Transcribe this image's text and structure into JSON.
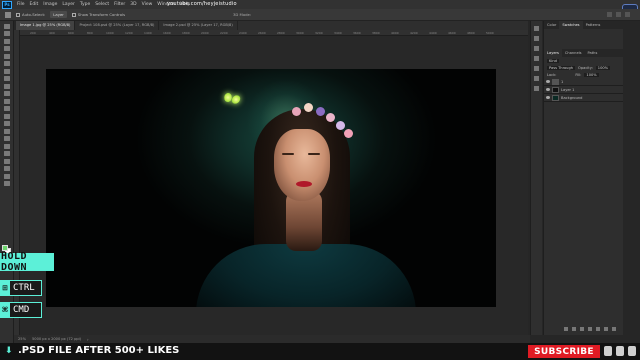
{
  "menu": {
    "app_icon": "Ps",
    "items": [
      "File",
      "Edit",
      "Image",
      "Layer",
      "Type",
      "Select",
      "Filter",
      "3D",
      "View",
      "Window",
      "Help"
    ],
    "watermark": "youtube.com/heyjeistudio"
  },
  "options_bar": {
    "auto_select_label": "Auto-Select:",
    "auto_select_value": "Layer",
    "show_transform": "Show Transform Controls",
    "mode_3d": "3D Mode:"
  },
  "tabs": [
    {
      "label": "Image 1.jpg @ 25% (RGB/8)",
      "active": true
    },
    {
      "label": "Project 108.psd @ 25% (Layer 17, RGB/8)",
      "active": false
    },
    {
      "label": "Image 2.psd @ 25% (Layer 17, RGB/8)",
      "active": false
    }
  ],
  "ruler_ticks": [
    "200",
    "400",
    "600",
    "800",
    "1000",
    "1200",
    "1400",
    "1600",
    "1800",
    "2000",
    "2200",
    "2400",
    "2600",
    "2800",
    "3000",
    "3200",
    "3400",
    "3600",
    "3800",
    "4000",
    "4200",
    "4400",
    "4600",
    "4800",
    "5000"
  ],
  "panel": {
    "top_tabs": [
      "Color",
      "Swatches",
      "Patterns"
    ],
    "active_top_tab": "Swatches",
    "sub_tabs": [
      "Layers",
      "Channels",
      "Paths"
    ],
    "active_sub_tab": "Layers",
    "kind_label": "Kind",
    "blend_mode": "Pass Through",
    "opacity_label": "Opacity:",
    "opacity_value": "100%",
    "lock_label": "Lock:",
    "fill_label": "Fill:",
    "fill_value": "100%",
    "layers": [
      {
        "name": "1",
        "thumb": "folder"
      },
      {
        "name": "Layer 1",
        "thumb": "dark"
      },
      {
        "name": "Background",
        "thumb": "photo"
      }
    ]
  },
  "status": {
    "zoom": "25%",
    "doc_info": "5000 px x 2000 px (72 ppi)"
  },
  "overlay": {
    "hold_down": "HOLD DOWN",
    "key1_icon": "⊞",
    "key1": "CTRL",
    "key2_icon": "⌘",
    "key2": "CMD",
    "bottom_text": ".PSD FILE AFTER 500+ LIKES",
    "subscribe": "SUBSCRIBE"
  },
  "colors": {
    "accent": "#5cf0d8",
    "subscribe_red": "#e01b24",
    "foreground_swatch": "#6dd46d",
    "background_swatch": "#ffffff"
  }
}
